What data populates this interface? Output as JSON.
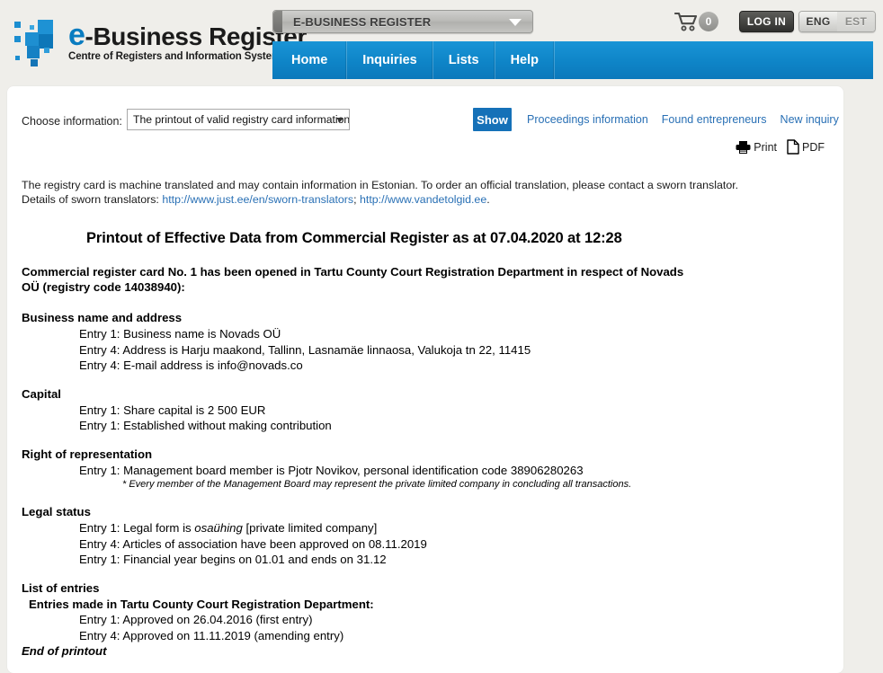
{
  "header": {
    "logo": {
      "title_e": "e",
      "title_rest": "-Business Register",
      "subtitle": "Centre of Registers and Information Systems"
    },
    "register_selector": {
      "label": "E-BUSINESS REGISTER",
      "icon": "chevron-down-icon"
    },
    "cart": {
      "icon": "shopping-cart-icon",
      "count": "0"
    },
    "login_label": "LOG IN",
    "languages": [
      {
        "code": "ENG",
        "active": true
      },
      {
        "code": "EST",
        "active": false
      }
    ],
    "nav": [
      {
        "label": "Home"
      },
      {
        "label": "Inquiries"
      },
      {
        "label": "Lists"
      },
      {
        "label": "Help"
      }
    ]
  },
  "toolbar": {
    "choose_label": "Choose information:",
    "dropdown_value": "The printout of valid registry card information in English",
    "show_label": "Show",
    "links": [
      {
        "label": "Proceedings information"
      },
      {
        "label": "Found entrepreneurs"
      },
      {
        "label": "New inquiry"
      }
    ],
    "print_label": "Print",
    "print_icon": "printer-icon",
    "pdf_label": "PDF",
    "pdf_icon": "document-page-icon"
  },
  "disclaimer": {
    "line1": "The registry card is machine translated and may contain information in Estonian. To order an official translation, please contact a sworn translator.",
    "line2_prefix": "Details of sworn translators: ",
    "link1": "http://www.just.ee/en/sworn-translators",
    "separator": "; ",
    "link2": "http://www.vandetolgid.ee",
    "line2_suffix": "."
  },
  "document": {
    "title": "Printout of Effective Data from Commercial Register as at 07.04.2020 at 12:28",
    "intro": "Commercial register card No. 1 has been opened in Tartu County Court Registration Department in respect of Novads OÜ (registry code 14038940):",
    "sections": [
      {
        "heading": "Business name and address",
        "entries": [
          "Entry 1: Business name is Novads OÜ",
          "Entry 4: Address is Harju maakond, Tallinn, Lasnamäe linnaosa, Valukoja tn 22, 11415",
          "Entry 4: E-mail address is info@novads.co"
        ]
      },
      {
        "heading": "Capital",
        "entries": [
          "Entry 1: Share capital is 2 500 EUR",
          "Entry 1: Established without making contribution"
        ]
      },
      {
        "heading": "Right of representation",
        "entries": [
          "Entry 1: Management board member is Pjotr Novikov, personal identification code 38906280263"
        ],
        "footnote": "* Every member of the Management Board may represent the private limited company in concluding all transactions."
      },
      {
        "heading": "Legal status",
        "entries_rich": [
          {
            "prefix": "Entry 1: Legal form is ",
            "italic": "osaühing",
            "suffix": " [private limited company]"
          },
          {
            "prefix": "Entry 4: Articles of association have been approved on 08.11.2019",
            "italic": "",
            "suffix": ""
          },
          {
            "prefix": "Entry 1: Financial year begins on 01.01 and ends on 31.12",
            "italic": "",
            "suffix": ""
          }
        ]
      },
      {
        "heading": "List of entries",
        "subheading": "Entries made in Tartu County Court Registration Department:",
        "entries": [
          "Entry 1: Approved on 26.04.2016 (first entry)",
          "Entry 4: Approved on 11.11.2019 (amending entry)"
        ]
      }
    ],
    "end_note": "End of printout"
  },
  "colors": {
    "nav_blue": "#0f86c9",
    "link_blue": "#2970b5",
    "show_blue": "#1571b8",
    "page_bg": "#efeeea",
    "logo_blue": "#0a7cc0"
  }
}
